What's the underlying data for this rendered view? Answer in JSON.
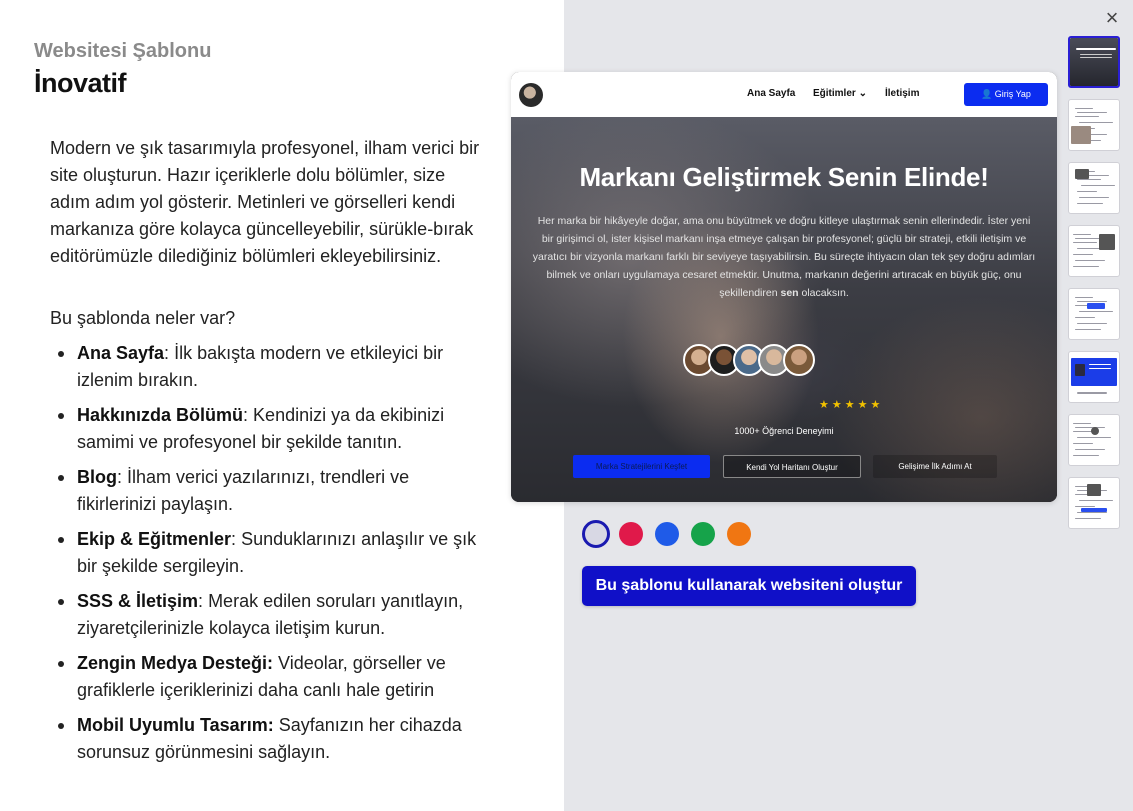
{
  "panel": {
    "subtitle": "Websitesi Şablonu",
    "title": "İnovatif",
    "description": "Modern ve şık tasarımıyla profesyonel, ilham verici bir site oluşturun. Hazır içeriklerle dolu bölümler, size adım adım yol gösterir. Metinleri ve görselleri kendi markanıza göre kolayca güncelleyebilir, sürükle-bırak editörümüzle dilediğiniz bölümleri ekleyebilirsiniz.",
    "question": "Bu şablonda neler var?",
    "features": [
      {
        "title": "Ana Sayfa",
        "sep": ":",
        "text": " İlk bakışta modern ve etkileyici bir izlenim bırakın."
      },
      {
        "title": "Hakkınızda Bölümü",
        "sep": ":",
        "text": " Kendinizi ya da ekibinizi samimi ve profesyonel bir şekilde tanıtın."
      },
      {
        "title": "Blog",
        "sep": ":",
        "text": " İlham verici yazılarınızı, trendleri ve fikirlerinizi paylaşın."
      },
      {
        "title": "Ekip & Eğitmenler",
        "sep": ":",
        "text": " Sunduklarınızı anlaşılır ve şık bir şekilde sergileyin."
      },
      {
        "title": "SSS & İletişim",
        "sep": ":",
        "text": " Merak edilen soruları yanıtlayın, ziyaretçilerinizle kolayca iletişim kurun."
      },
      {
        "title": "Zengin Medya Desteği:",
        "sep": "",
        "text": " Videolar, görseller ve grafiklerle içeriklerinizi daha canlı hale getirin"
      },
      {
        "title": "Mobil Uyumlu Tasarım:",
        "sep": "",
        "text": " Sayfanızın her cihazda sorunsuz görünmesini sağlayın."
      }
    ]
  },
  "close_icon": "×",
  "preview": {
    "nav": {
      "home": "Ana Sayfa",
      "trainings": "Eğitimler ⌄",
      "contact": "İletişim",
      "login": "👤 Giriş Yap"
    },
    "headline": "Markanı Geliştirmek Senin Elinde!",
    "body_parts": [
      "Her marka bir hikâyeyle doğar, ama onu büyütmek ve doğru kitleye ulaştırmak senin ellerindedir. İster yeni bir girişimci ol, ister kişisel markanı inşa etmeye çalışan bir profesyonel; güçlü bir strateji, etkili iletişim ve yaratıcı bir vizyonla markanı farklı bir seviyeye taşıyabilirsin. Bu süreçte ihtiyacın olan tek şey doğru adımları bilmek ve onları uygulamaya cesaret etmektir. Unutma, markanın değerini artıracak en büyük güç, onu şekillendiren ",
      "sen",
      " olacaksın."
    ],
    "stars": "★★★★★",
    "students": "1000+ Öğrenci Deneyimi",
    "buttons": [
      "Marka Stratejilerini Keşfet",
      "Kendi Yol Haritanı Oluştur",
      "Gelişime İlk Adımı At"
    ]
  },
  "colors": {
    "swatches": [
      "#d8d8e4",
      "#e0194a",
      "#1f5be8",
      "#16a34a",
      "#f07612"
    ],
    "selected_index": 0
  },
  "cta": "Bu şablonu kullanarak websiteni oluştur",
  "thumbnails": {
    "count": 8,
    "active_index": 0
  }
}
